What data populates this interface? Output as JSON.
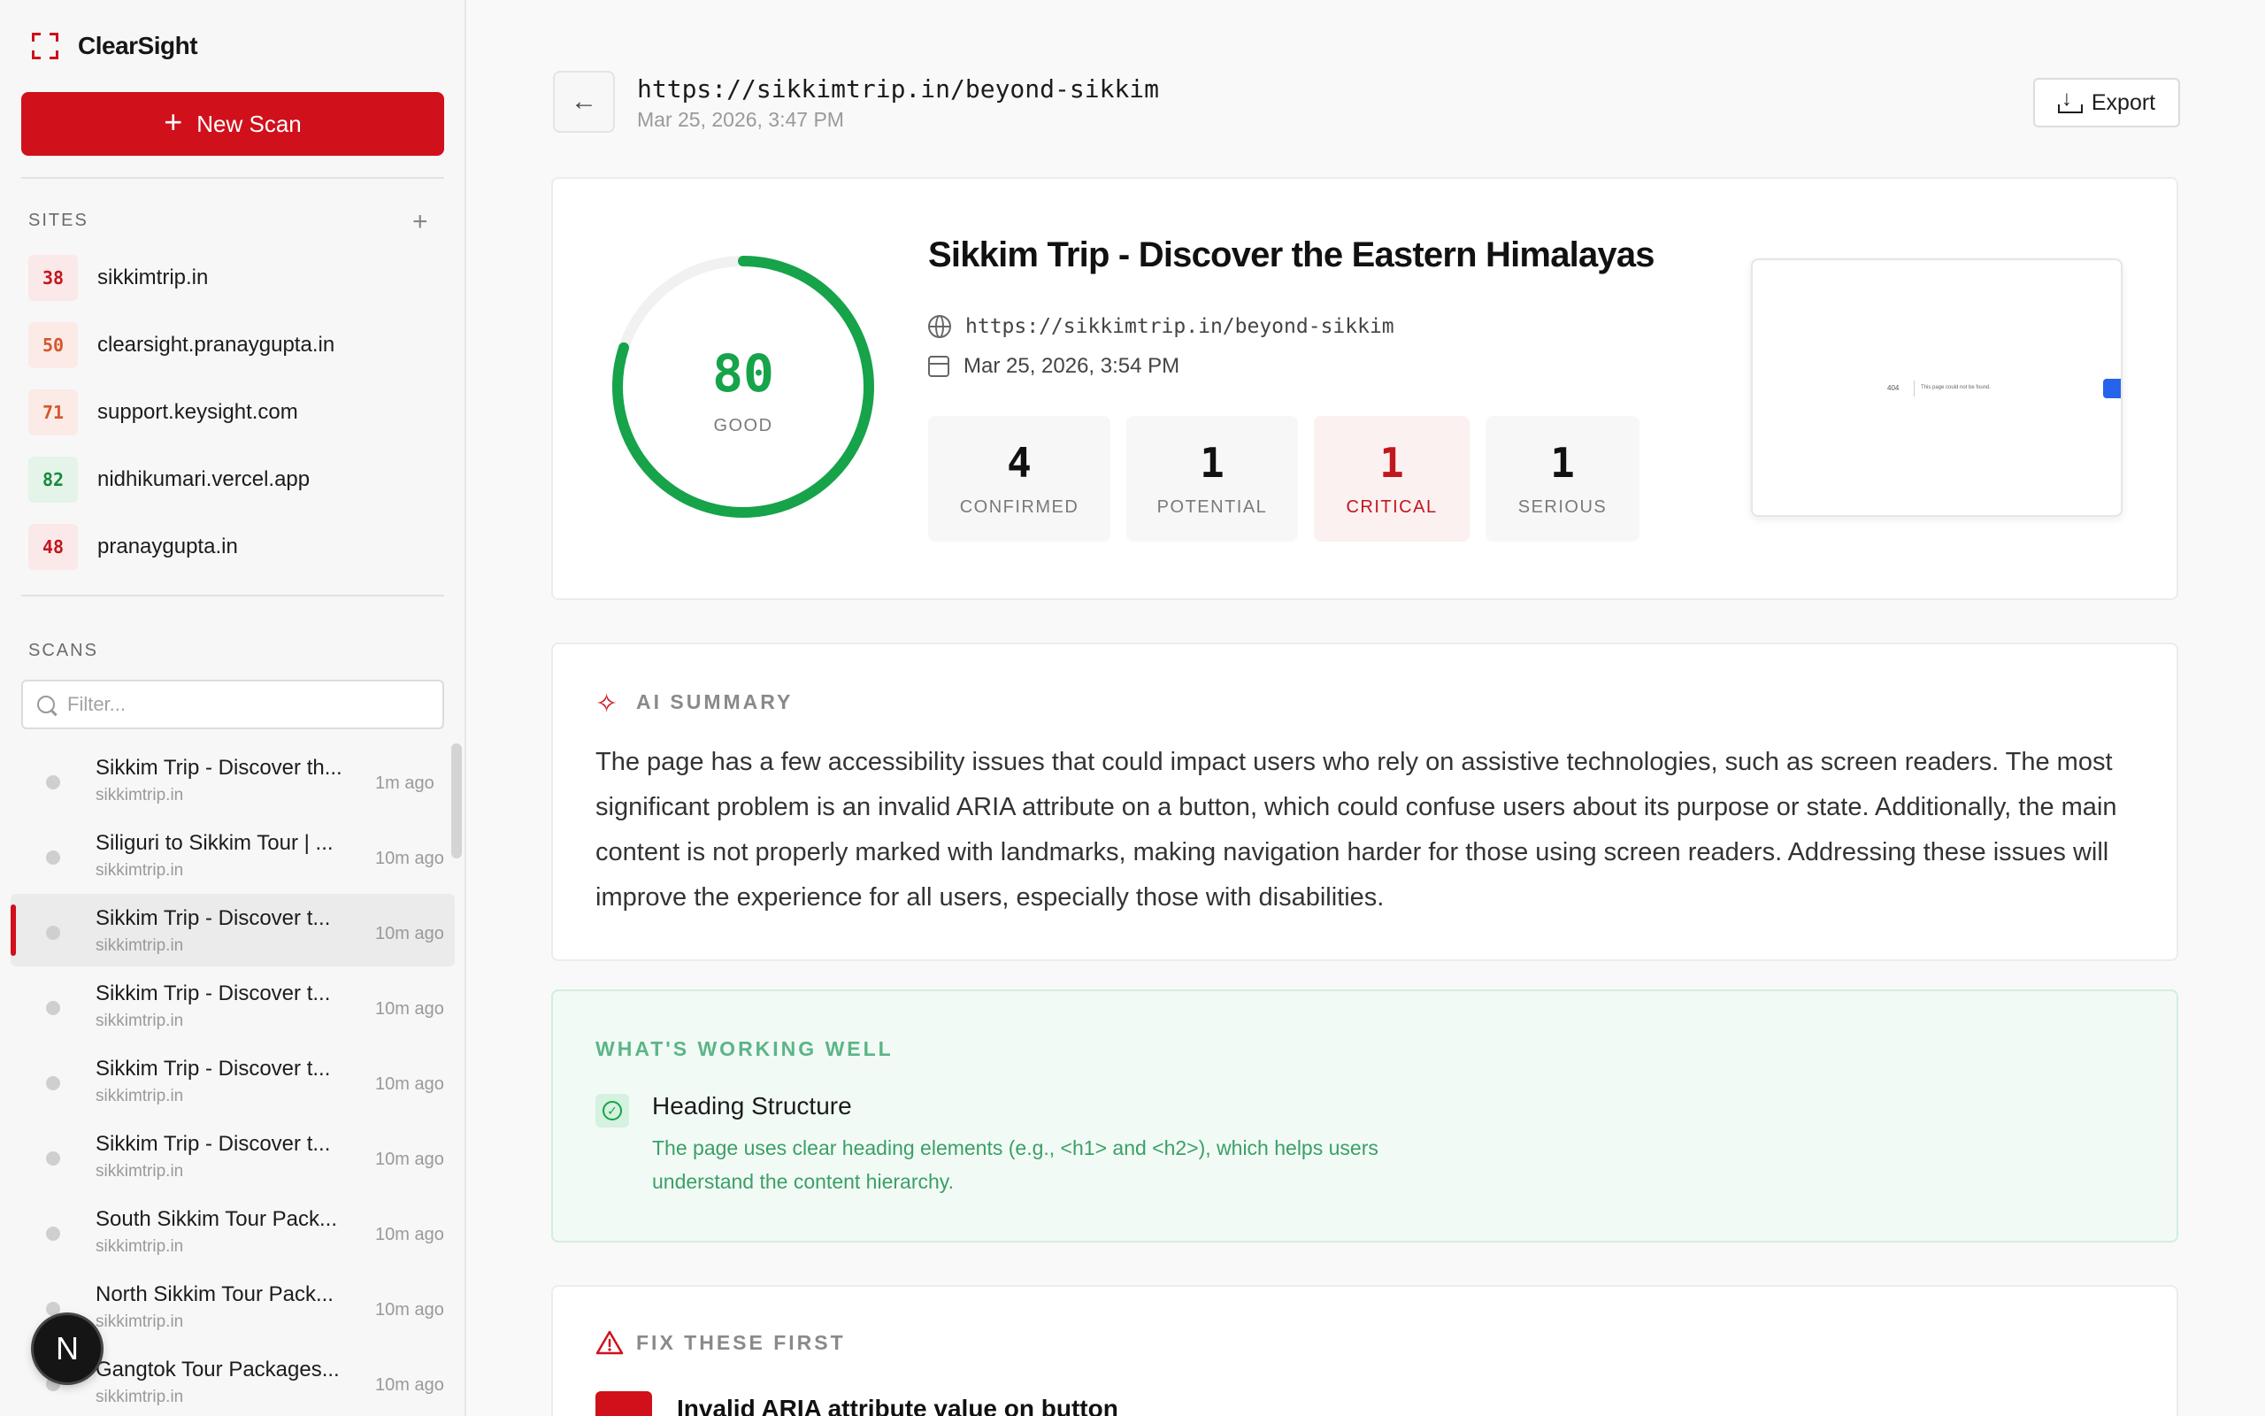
{
  "app": {
    "name": "ClearSight",
    "new_scan_label": "New Scan"
  },
  "sites": {
    "label": "SITES",
    "add_label": "+",
    "items": [
      {
        "score": "38",
        "name": "sikkimtrip.in",
        "tone": "red"
      },
      {
        "score": "50",
        "name": "clearsight.pranaygupta.in",
        "tone": "orange"
      },
      {
        "score": "71",
        "name": "support.keysight.com",
        "tone": "orange"
      },
      {
        "score": "82",
        "name": "nidhikumari.vercel.app",
        "tone": "green"
      },
      {
        "score": "48",
        "name": "pranaygupta.in",
        "tone": "red"
      }
    ]
  },
  "scans": {
    "label": "SCANS",
    "filter_placeholder": "Filter...",
    "items": [
      {
        "title": "Sikkim Trip - Discover th...",
        "domain": "sikkimtrip.in",
        "time": "1m ago",
        "active": false
      },
      {
        "title": "Siliguri to Sikkim Tour | ...",
        "domain": "sikkimtrip.in",
        "time": "10m ago",
        "active": false
      },
      {
        "title": "Sikkim Trip - Discover t...",
        "domain": "sikkimtrip.in",
        "time": "10m ago",
        "active": true
      },
      {
        "title": "Sikkim Trip - Discover t...",
        "domain": "sikkimtrip.in",
        "time": "10m ago",
        "active": false
      },
      {
        "title": "Sikkim Trip - Discover t...",
        "domain": "sikkimtrip.in",
        "time": "10m ago",
        "active": false
      },
      {
        "title": "Sikkim Trip - Discover t...",
        "domain": "sikkimtrip.in",
        "time": "10m ago",
        "active": false
      },
      {
        "title": "South Sikkim Tour Pack...",
        "domain": "sikkimtrip.in",
        "time": "10m ago",
        "active": false
      },
      {
        "title": "North Sikkim Tour Pack...",
        "domain": "sikkimtrip.in",
        "time": "10m ago",
        "active": false
      },
      {
        "title": "Gangtok Tour Packages...",
        "domain": "sikkimtrip.in",
        "time": "10m ago",
        "active": false
      }
    ]
  },
  "avatar": {
    "initial": "N"
  },
  "header": {
    "url": "https://sikkimtrip.in/beyond-sikkim",
    "date": "Mar 25, 2026, 3:47 PM",
    "export_label": "Export"
  },
  "report": {
    "score": "80",
    "score_fraction": 0.8,
    "score_label": "GOOD",
    "title": "Sikkim Trip - Discover the Eastern Himalayas",
    "url": "https://sikkimtrip.in/beyond-sikkim",
    "scanned_at": "Mar 25, 2026, 3:54 PM",
    "stats": [
      {
        "value": "4",
        "label": "CONFIRMED"
      },
      {
        "value": "1",
        "label": "POTENTIAL"
      },
      {
        "value": "1",
        "label": "CRITICAL"
      },
      {
        "value": "1",
        "label": "SERIOUS"
      }
    ],
    "thumbnail": {
      "code": "404",
      "message": "This page could not be found."
    }
  },
  "summary": {
    "label": "AI SUMMARY",
    "text": "The page has a few accessibility issues that could impact users who rely on assistive technologies, such as screen readers. The most significant problem is an invalid ARIA attribute on a button, which could confuse users about its purpose or state. Additionally, the main content is not properly marked with landmarks, making navigation harder for those using screen readers. Addressing these issues will improve the experience for all users, especially those with disabilities."
  },
  "working_well": {
    "label": "WHAT'S WORKING WELL",
    "items": [
      {
        "title": "Heading Structure",
        "description": "The page uses clear heading elements (e.g., <h1> and <h2>), which helps users understand the content hierarchy."
      }
    ]
  },
  "fix_first": {
    "label": "FIX THESE FIRST",
    "items": [
      {
        "title": "Invalid ARIA attribute value on button"
      }
    ]
  },
  "colors": {
    "accent": "#d0101b",
    "good": "#16a34a",
    "critical": "#c2161e"
  }
}
